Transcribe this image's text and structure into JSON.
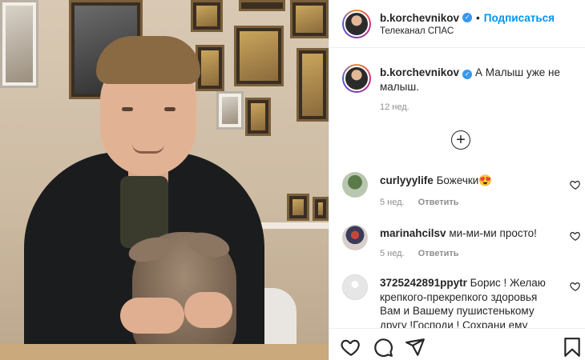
{
  "header": {
    "username": "b.korchevnikov",
    "dot": "•",
    "follow_label": "Подписаться",
    "location": "Телеканал СПАС"
  },
  "caption": {
    "username": "b.korchevnikov",
    "text": "А Малыш уже не малыш.",
    "time": "12 нед."
  },
  "load_more_icon": "plus-circle-icon",
  "comments": [
    {
      "username": "curlyyylife",
      "text": "Божечки😍",
      "time": "5 нед.",
      "reply_label": "Ответить"
    },
    {
      "username": "marinahcilsv",
      "text": "ми-ми-ми просто!",
      "time": "5 нед.",
      "reply_label": "Ответить"
    },
    {
      "username": "3725242891ppytr",
      "text": "Борис ! Желаю крепкого-прекрепкого здоровья Вам и Вашему пушистенькому другу !Господи ! Сохрани ему"
    }
  ],
  "actions": {
    "icons": [
      "heart-icon",
      "comment-icon",
      "share-icon",
      "bookmark-icon"
    ]
  },
  "colors": {
    "accent": "#0095f6",
    "verified": "#3897f0",
    "muted": "#8e8e8e"
  }
}
